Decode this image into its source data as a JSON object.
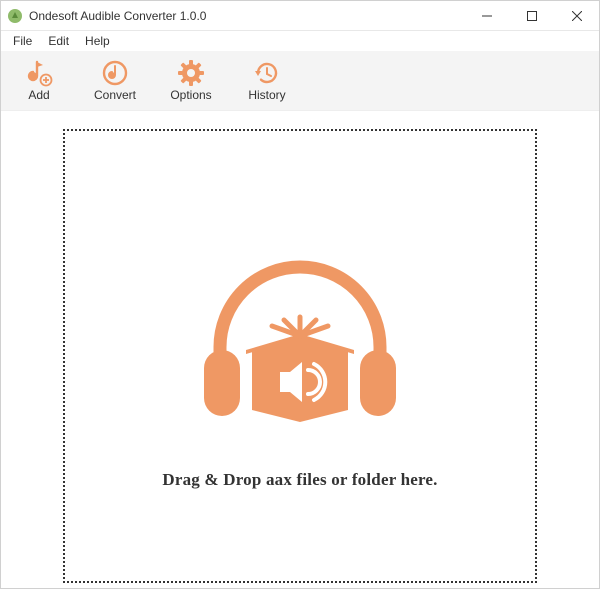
{
  "titlebar": {
    "title": "Ondesoft Audible Converter 1.0.0"
  },
  "menubar": {
    "items": [
      "File",
      "Edit",
      "Help"
    ]
  },
  "toolbar": {
    "add_label": "Add",
    "convert_label": "Convert",
    "options_label": "Options",
    "history_label": "History"
  },
  "main": {
    "drop_message": "Drag & Drop aax files or folder here."
  },
  "colors": {
    "accent": "#ef9864"
  }
}
